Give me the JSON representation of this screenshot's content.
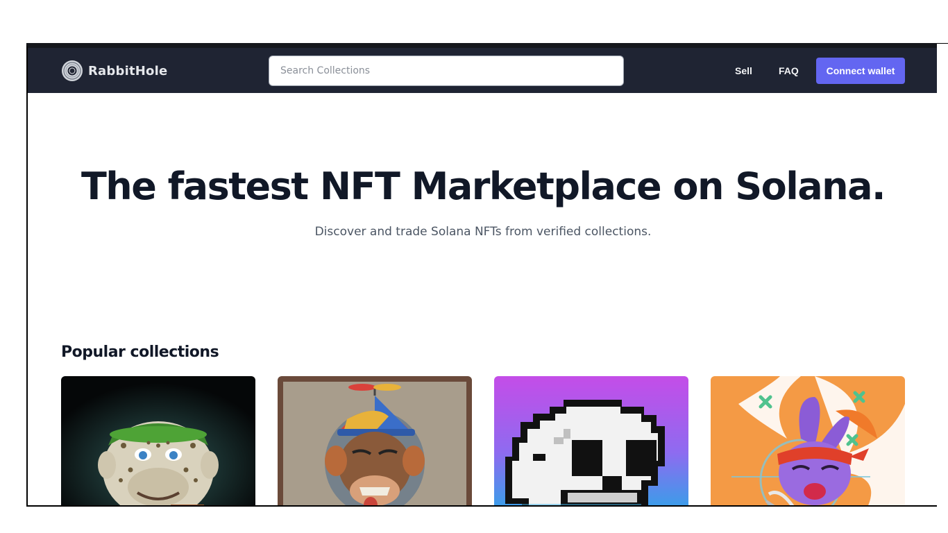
{
  "header": {
    "brand_name": "RabbitHole",
    "logo_icon": "rabbithole-logo-icon",
    "search_placeholder": "Search Collections",
    "nav": {
      "sell": "Sell",
      "faq": "FAQ"
    },
    "connect_wallet": "Connect wallet"
  },
  "hero": {
    "title": "The fastest NFT Marketplace on Solana.",
    "subtitle": "Discover and trade Solana NFTs from verified collections."
  },
  "popular": {
    "title": "Popular collections",
    "collections": [
      {
        "image": "leopard-ape-with-green-bandana"
      },
      {
        "image": "ape-with-propeller-cap"
      },
      {
        "image": "pixel-skull"
      },
      {
        "image": "purple-rabbit-with-red-bandana"
      }
    ]
  },
  "colors": {
    "navbar_bg": "#1f2433",
    "accent": "#6366f1",
    "title_text": "#111827"
  }
}
